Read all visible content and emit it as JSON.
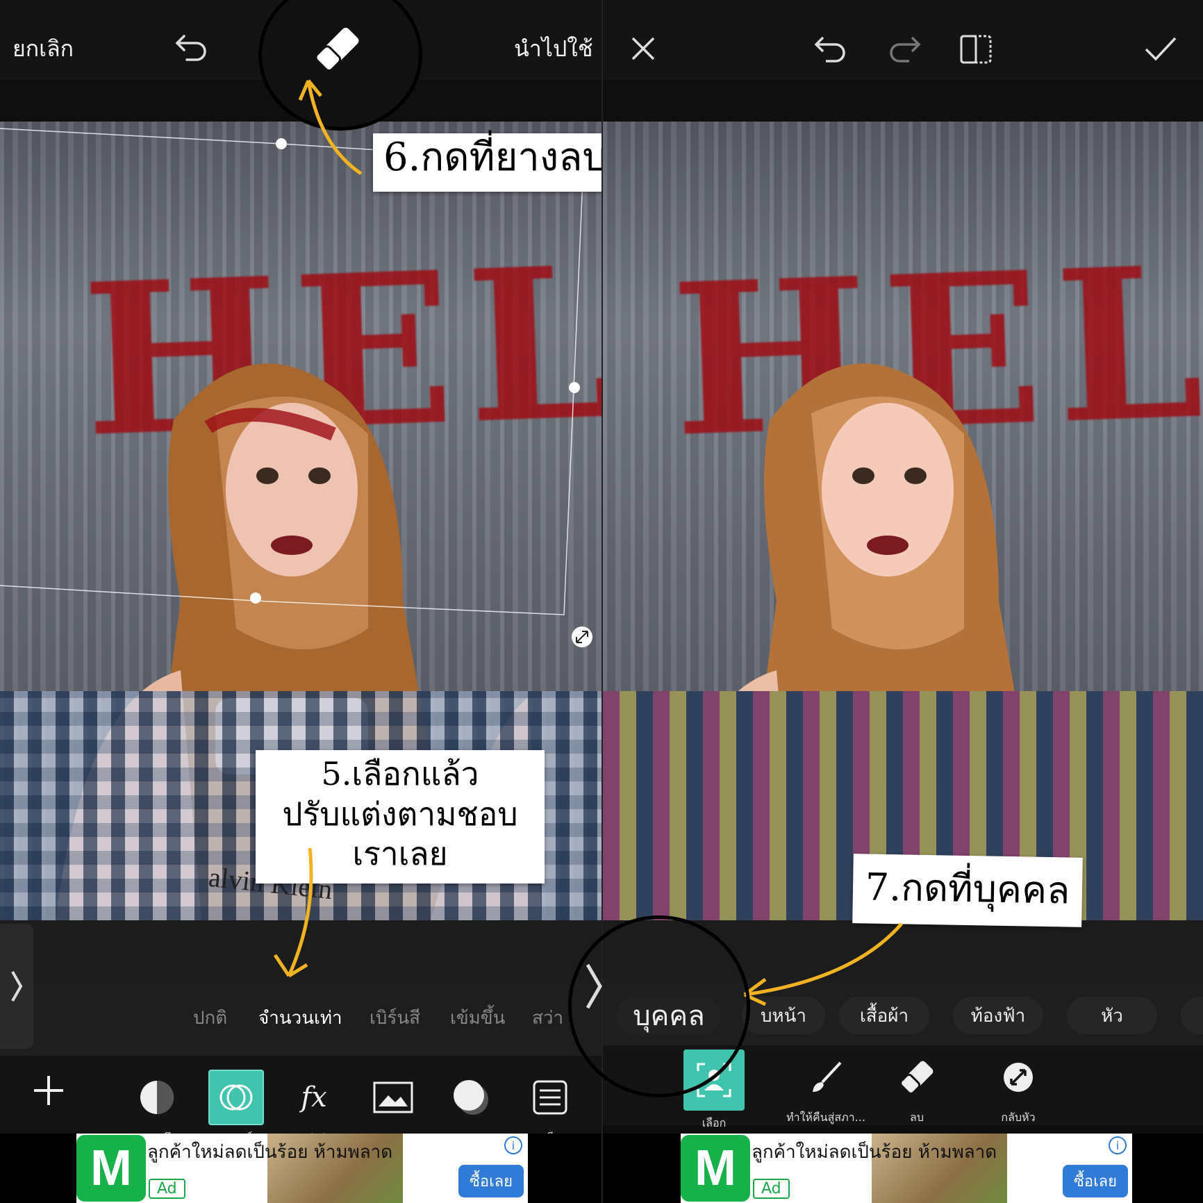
{
  "left": {
    "topbar": {
      "cancel": "ยกเลิก",
      "apply": "นำไปใช้"
    },
    "blend_modes": [
      "ปกติ",
      "จำนวนเท่า",
      "เบิร์นสี",
      "เข้มขึ้น",
      "สว่า"
    ],
    "blend_active_index": 1,
    "tools": [
      {
        "label": "ความทึบ"
      },
      {
        "label": "เบลนด์"
      },
      {
        "label": "เอฟเฟค"
      },
      {
        "label": "ขอบ"
      },
      {
        "label": "เงา"
      },
      {
        "label": "สี"
      }
    ],
    "photo_text": "HELP",
    "shorts_text": "alvin Klein",
    "callout_step6": "6.กดที่ยางลบ",
    "callout_step5_line1": "5.เลือกแล้ว",
    "callout_step5_line2": "ปรับแต่งตามชอบ",
    "callout_step5_line3": "เราเลย"
  },
  "right": {
    "photo_text": "HELP",
    "chips": [
      "บุคคล",
      "บหน้า",
      "เสื้อผ้า",
      "ท้องฟ้า",
      "หัว"
    ],
    "tools": [
      {
        "label": "เลือก"
      },
      {
        "label": "ทำให้คืนสู่สภา..."
      },
      {
        "label": "ลบ"
      },
      {
        "label": "กลับหัว"
      }
    ],
    "callout_step7": "7.กดที่บุคคล"
  },
  "ad": {
    "title": "ลูกค้าใหม่ลดเป็นร้อย ห้ามพลาด",
    "tag": "Ad",
    "cta": "ซื้อเลย",
    "info": "i",
    "logo": "M"
  },
  "colors": {
    "accent": "#41c4ad",
    "arrow": "#f2b323",
    "blood": "#9e0d15"
  }
}
